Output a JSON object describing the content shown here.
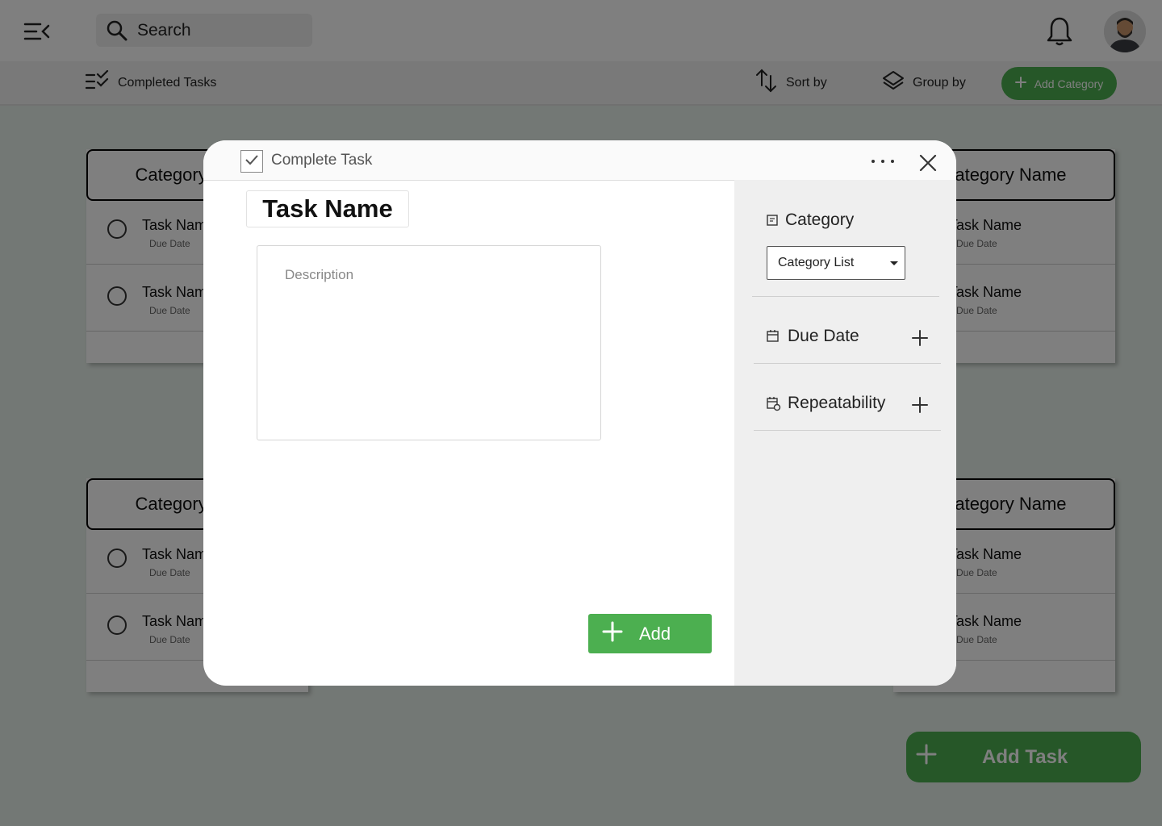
{
  "search": {
    "placeholder": "Search"
  },
  "toolbar": {
    "completed_label": "Completed Tasks",
    "sort_label": "Sort by",
    "group_label": "Group by",
    "add_category_label": "Add Category"
  },
  "columns": [
    {
      "title": "Category Name",
      "rows": [
        {
          "name": "Task Name",
          "date": "Due Date"
        },
        {
          "name": "Task Name",
          "date": "Due Date"
        }
      ]
    },
    {
      "title": "Category Name",
      "rows": [
        {
          "name": "Task Name",
          "date": "Due Date"
        },
        {
          "name": "Task Name",
          "date": "Due Date"
        }
      ]
    },
    {
      "title": "Category Name",
      "rows": [
        {
          "name": "Task Name",
          "date": "Due Date"
        },
        {
          "name": "Task Name",
          "date": "Due Date"
        }
      ]
    },
    {
      "title": "Category Name",
      "rows": [
        {
          "name": "Task Name",
          "date": "Due Date"
        },
        {
          "name": "Task Name",
          "date": "Due Date"
        }
      ]
    }
  ],
  "add_task_label": "Add Task",
  "modal": {
    "complete_label": "Complete Task",
    "title": "Task Name",
    "description_placeholder": "Description",
    "add_label": "Add",
    "category_label": "Category",
    "category_value": "Category List",
    "due_date_label": "Due Date",
    "repeatability_label": "Repeatability"
  },
  "colors": {
    "accent": "#4caf50",
    "overlay": "rgba(0,0,0,0.5)"
  }
}
